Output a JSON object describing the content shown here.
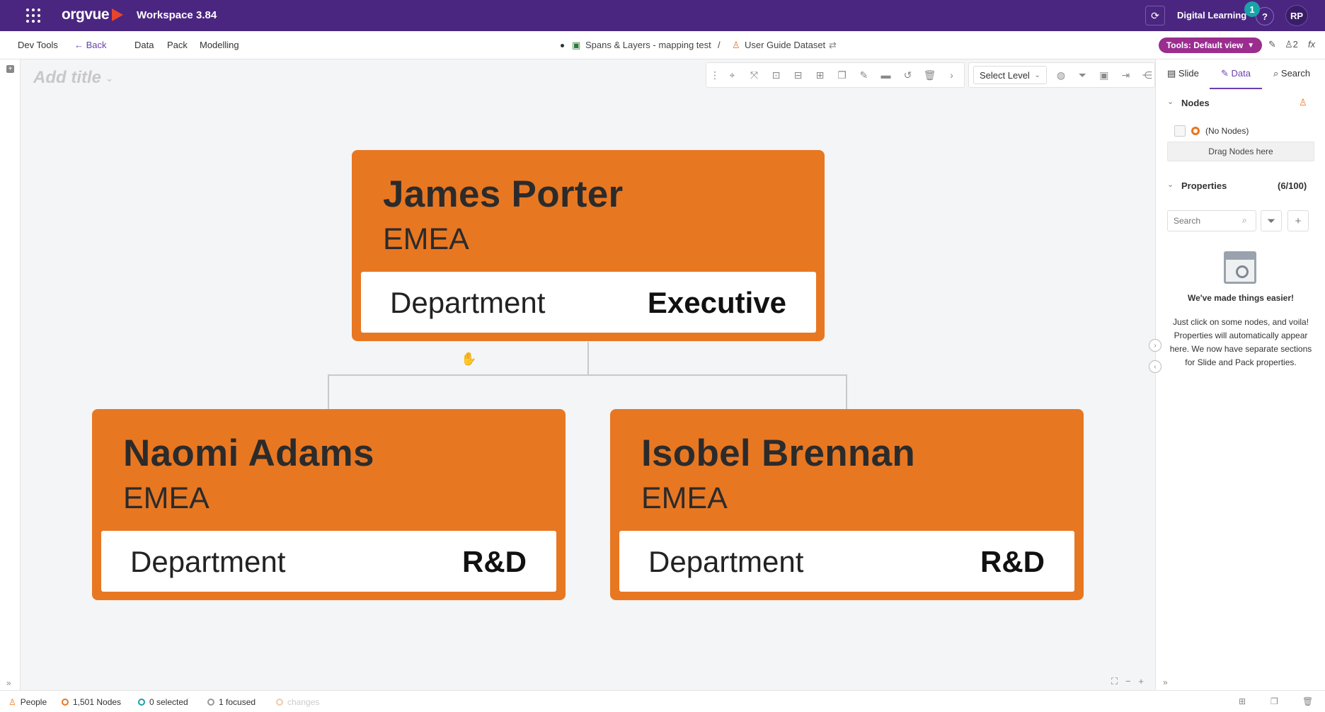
{
  "topbar": {
    "logo": "orgvue",
    "workspace_label": "Workspace",
    "version": "3.84",
    "user_label": "Digital Learning",
    "notification_count": "1",
    "help": "?",
    "avatar_initials": "RP"
  },
  "subbar": {
    "dev_tools": "Dev Tools",
    "back": "Back",
    "nav": [
      "Data",
      "Pack",
      "Modelling"
    ],
    "breadcrumb_project": "Spans & Layers - mapping test",
    "breadcrumb_sep": "/",
    "breadcrumb_dataset": "User Guide Dataset",
    "tools_button": "Tools: Default view",
    "user_count": "2",
    "fx": "fx"
  },
  "canvas": {
    "add_title_placeholder": "Add title",
    "select_level": "Select Level"
  },
  "org_chart": {
    "nodes": [
      {
        "name": "James Porter",
        "region": "EMEA",
        "dept_label": "Department",
        "dept_value": "Executive"
      },
      {
        "name": "Naomi Adams",
        "region": "EMEA",
        "dept_label": "Department",
        "dept_value": "R&D"
      },
      {
        "name": "Isobel Brennan",
        "region": "EMEA",
        "dept_label": "Department",
        "dept_value": "R&D"
      }
    ],
    "node_color": "#e87722"
  },
  "right_panel": {
    "tabs": [
      "Slide",
      "Data",
      "Search"
    ],
    "active_tab": "Data",
    "nodes_section": "Nodes",
    "no_nodes": "(No Nodes)",
    "drag_nodes": "Drag Nodes here",
    "properties_section": "Properties",
    "properties_count": "(6/100)",
    "search_placeholder": "Search",
    "empty_title": "We've made things easier!",
    "empty_body": "Just click on some nodes, and voila! Properties will automatically appear here. We now have separate sections for Slide and Pack properties."
  },
  "statusbar": {
    "people": "People",
    "nodes": "1,501 Nodes",
    "selected": "0 selected",
    "focused": "1 focused",
    "changes": "changes"
  },
  "colors": {
    "topbar": "#4a2680",
    "accent": "#6a3fb0",
    "tools_button": "#9b2d8f",
    "badge": "#18a3a8"
  }
}
